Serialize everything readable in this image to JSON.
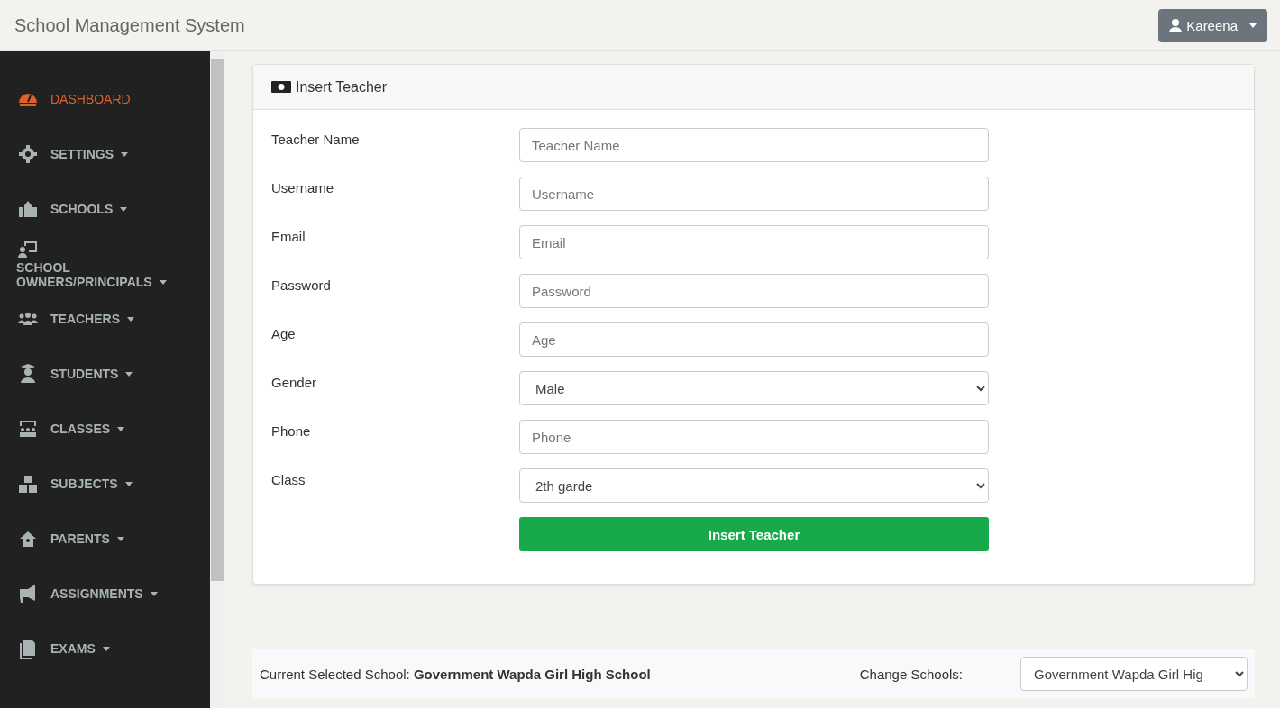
{
  "header": {
    "title": "School Management System",
    "user_button": "Kareena"
  },
  "sidebar": {
    "items": [
      {
        "label": "DASHBOARD",
        "selected": true,
        "expandable": false
      },
      {
        "label": "SETTINGS",
        "selected": false,
        "expandable": true
      },
      {
        "label": "SCHOOLS",
        "selected": false,
        "expandable": true
      },
      {
        "label": "SCHOOL OWNERS/PRINCIPALS",
        "selected": false,
        "expandable": true
      },
      {
        "label": "TEACHERS",
        "selected": false,
        "expandable": true
      },
      {
        "label": "STUDENTS",
        "selected": false,
        "expandable": true
      },
      {
        "label": "CLASSES",
        "selected": false,
        "expandable": true
      },
      {
        "label": "SUBJECTS",
        "selected": false,
        "expandable": true
      },
      {
        "label": "PARENTS",
        "selected": false,
        "expandable": true
      },
      {
        "label": "ASSIGNMENTS",
        "selected": false,
        "expandable": true
      },
      {
        "label": "EXAMS",
        "selected": false,
        "expandable": true
      }
    ]
  },
  "card": {
    "title": "Insert Teacher",
    "fields": [
      {
        "kind": "input",
        "label": "Teacher Name",
        "placeholder": "Teacher Name"
      },
      {
        "kind": "input",
        "label": "Username",
        "placeholder": "Username"
      },
      {
        "kind": "input",
        "label": "Email",
        "placeholder": "Email"
      },
      {
        "kind": "input",
        "label": "Password",
        "placeholder": "Password"
      },
      {
        "kind": "input",
        "label": "Age",
        "placeholder": "Age"
      },
      {
        "kind": "select",
        "label": "Gender",
        "value": "Male"
      },
      {
        "kind": "input",
        "label": "Phone",
        "placeholder": "Phone"
      },
      {
        "kind": "select",
        "label": "Class",
        "value": "2th garde"
      }
    ],
    "submit": "Insert Teacher"
  },
  "footer": {
    "current_label": "Current Selected School:",
    "current_school": "Government Wapda Girl High School",
    "change_label": "Change Schools:",
    "change_value": "Government Wapda Girl Hig"
  }
}
